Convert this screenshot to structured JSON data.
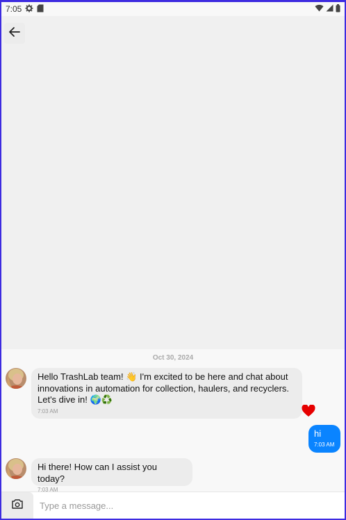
{
  "status_bar": {
    "time": "7:05",
    "icons": [
      "settings-icon",
      "sd-card-icon",
      "wifi-icon",
      "signal-icon",
      "battery-icon"
    ]
  },
  "header": {
    "back_icon": "arrow-left-icon"
  },
  "chat": {
    "date_separator": "Oct 30, 2024",
    "messages": [
      {
        "direction": "incoming",
        "text": "Hello TrashLab team! 👋 I'm excited to be here and chat about innovations in automation for collection, haulers, and recyclers. Let's dive in! 🌍♻️",
        "time": "7:03 AM",
        "reaction": "heart-icon"
      },
      {
        "direction": "outgoing",
        "text": "hi",
        "time": "7:03 AM"
      },
      {
        "direction": "incoming",
        "text": "Hi there! How can I assist you today?",
        "time": "7:03 AM"
      }
    ]
  },
  "composer": {
    "placeholder": "Type a message...",
    "value": "",
    "camera_icon": "camera-icon"
  },
  "colors": {
    "outgoing_bubble": "#0a84ff",
    "incoming_bubble": "#ececec",
    "reaction": "#e60000",
    "frame_border": "#3d2be0"
  }
}
